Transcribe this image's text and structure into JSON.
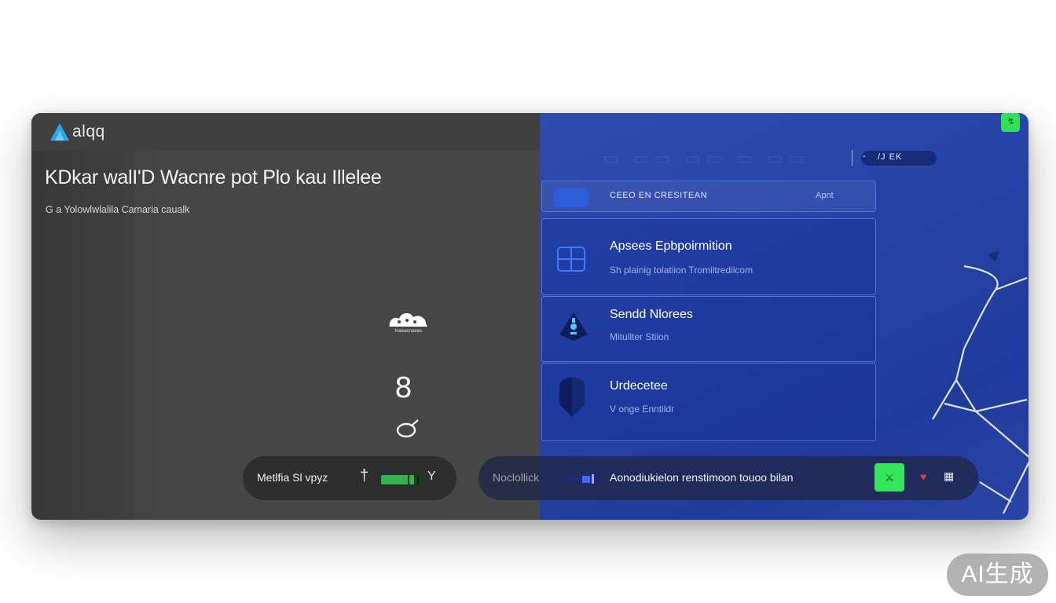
{
  "app": {
    "logo_text": "alqq",
    "headline": "KDkar walI'D Wacnre pot Plo kau Illelee",
    "subline": "G a Yolowlwlalila Camaria caualk"
  },
  "left_panel": {
    "cloud_caption": "lnaeasnaeas",
    "glyph_eight": "8"
  },
  "left_pill": {
    "label": "Metlfia Sl vpyz",
    "cross_icon": "†",
    "meter_level": 0.78,
    "end_icon": "Y"
  },
  "toolbar": {
    "dash": "‑",
    "chip_text": "/J EK"
  },
  "list": {
    "header_title": "CEEO EN CRESITEAN",
    "header_aside": "Apnt",
    "items": [
      {
        "title": "Apsees Epbpoirmition",
        "subtitle": "Sh plainig tolatiion Tromiltredilcom"
      },
      {
        "title": "Sendd  Nlorees",
        "subtitle": "Mitullter Stiion"
      },
      {
        "title": "Urdecetee",
        "subtitle": "V onge Enntildr"
      }
    ]
  },
  "right_pill": {
    "left_text": "Noclollick",
    "main_text": "Aonodiukielon renstimoon touoo bilan",
    "green_button_icon": "⚔",
    "heart_icon": "♥",
    "grid_icon": "▦"
  },
  "corner_button_icon": "↯",
  "watermark": "AI生成",
  "colors": {
    "left_bg": "#474747",
    "right_bg": "#2644a8",
    "accent_green": "#33e65b",
    "accent_blue": "#2d5ddb"
  }
}
